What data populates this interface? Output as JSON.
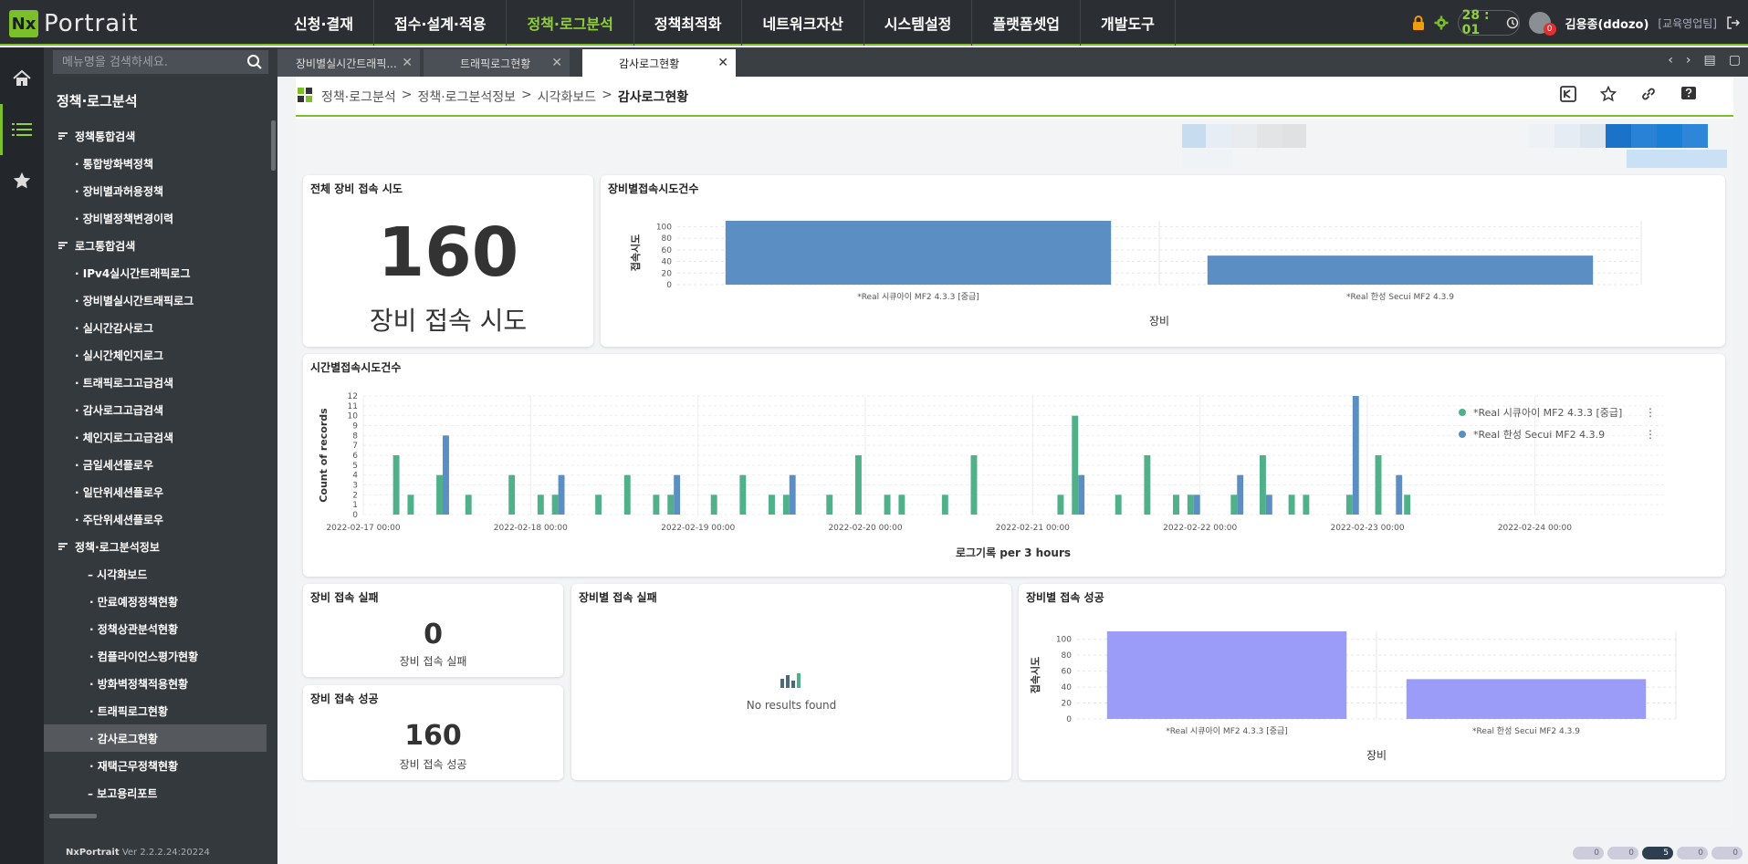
{
  "app": {
    "logo_mark": "Nx",
    "logo_text": "Portrait"
  },
  "nav": [
    {
      "label": "신청·결재"
    },
    {
      "label": "접수·설계·적용"
    },
    {
      "label": "정책·로그분석",
      "active": true
    },
    {
      "label": "정책최적화"
    },
    {
      "label": "네트워크자산"
    },
    {
      "label": "시스템설정"
    },
    {
      "label": "플랫폼셋업"
    },
    {
      "label": "개발도구"
    }
  ],
  "topright": {
    "timer": "28 : 01",
    "user_name": "김용종(ddozo)",
    "user_dept": "[교육영업팀]",
    "badge": "0"
  },
  "sidebar": {
    "search_placeholder": "메뉴명을 검색하세요.",
    "title": "정책·로그분석",
    "items": [
      {
        "label": "정책통합검색",
        "level": 0
      },
      {
        "label": "· 통합방화벽정책",
        "level": 1
      },
      {
        "label": "· 장비별과허용정책",
        "level": 1
      },
      {
        "label": "· 장비별정책변경이력",
        "level": 1
      },
      {
        "label": "로그통합검색",
        "level": 0
      },
      {
        "label": "· IPv4실시간트래픽로그",
        "level": 1
      },
      {
        "label": "· 장비별실시간트래픽로그",
        "level": 1
      },
      {
        "label": "· 실시간감사로그",
        "level": 1
      },
      {
        "label": "· 실시간체인지로그",
        "level": 1
      },
      {
        "label": "· 트래픽로그고급검색",
        "level": 1
      },
      {
        "label": "· 감사로그고급검색",
        "level": 1
      },
      {
        "label": "· 체인지로그고급검색",
        "level": 1
      },
      {
        "label": "· 금일세션플로우",
        "level": 1
      },
      {
        "label": "· 일단위세션플로우",
        "level": 1
      },
      {
        "label": "· 주단위세션플로우",
        "level": 1
      },
      {
        "label": "정책·로그분석정보",
        "level": 0
      },
      {
        "label": "– 시각화보드",
        "level": 2
      },
      {
        "label": "· 만료예정정책현황",
        "level": 3
      },
      {
        "label": "· 정책상관분석현황",
        "level": 3
      },
      {
        "label": "· 컴플라이언스평가현황",
        "level": 3
      },
      {
        "label": "· 방화벽정책적용현황",
        "level": 3
      },
      {
        "label": "· 트래픽로그현황",
        "level": 3
      },
      {
        "label": "· 감사로그현황",
        "level": 3,
        "active": true
      },
      {
        "label": "· 재택근무정책현황",
        "level": 3
      },
      {
        "label": "– 보고용리포트",
        "level": 2
      }
    ],
    "version_name": "NxPortrait",
    "version": "Ver 2.2.2.24:20224"
  },
  "tabs": [
    {
      "label": "장비별실시간트래픽..."
    },
    {
      "label": "트래픽로그현황"
    },
    {
      "label": "감사로그현황",
      "active": true
    }
  ],
  "breadcrumb": {
    "items": [
      "정책·로그분석",
      "정책·로그분석정보",
      "시각화보드"
    ],
    "sep": ">",
    "current": "감사로그현황"
  },
  "panels": {
    "total": {
      "title": "전체 장비 접속 시도",
      "value": "160",
      "label": "장비 접속 시도"
    },
    "fail": {
      "title": "장비 접속 실패",
      "value": "0",
      "label": "장비 접속 실패"
    },
    "success": {
      "title": "장비 접속 성공",
      "value": "160",
      "label": "장비 접속 성공"
    },
    "device_fail": {
      "title": "장비별 접속 실패",
      "empty": "No results found"
    },
    "device_attempt_title": "장비별접속시도건수",
    "time_title": "시간별접속시도건수",
    "device_success_title": "장비별 접속 성공"
  },
  "status_pills": [
    "0",
    "0",
    "5",
    "0",
    "0"
  ],
  "chart_data": [
    {
      "type": "bar",
      "title": "장비별접속시도건수",
      "categories": [
        "*Real 시큐아이 MF2 4.3.3 [중급]",
        "*Real 한성 Secui MF2 4.3.9"
      ],
      "values": [
        110,
        50
      ],
      "xlabel": "장비",
      "ylabel": "접속시도",
      "ylim": [
        0,
        110
      ],
      "yticks": [
        0,
        20,
        40,
        60,
        80,
        100
      ],
      "color": "#5b8ec3"
    },
    {
      "type": "bar",
      "title": "시간별접속시도건수",
      "xlabel": "로그기록 per 3 hours",
      "ylabel": "Count of records",
      "ylim": [
        0,
        12
      ],
      "yticks": [
        0,
        1,
        2,
        3,
        4,
        5,
        6,
        7,
        8,
        9,
        10,
        11,
        12
      ],
      "xticks": [
        "2022-02-17 00:00",
        "2022-02-18 00:00",
        "2022-02-19 00:00",
        "2022-02-20 00:00",
        "2022-02-21 00:00",
        "2022-02-22 00:00",
        "2022-02-23 00:00",
        "2022-02-24 00:00"
      ],
      "legend_position": "top-right",
      "series": [
        {
          "name": "*Real 시큐아이 MF2 4.3.3 [중급]",
          "color": "#4fb08a",
          "values": [
            0,
            0,
            6,
            2,
            0,
            4,
            0,
            2,
            0,
            0,
            4,
            0,
            2,
            2,
            0,
            0,
            2,
            0,
            4,
            0,
            2,
            2,
            0,
            0,
            2,
            0,
            4,
            0,
            2,
            2,
            0,
            0,
            2,
            0,
            6,
            0,
            2,
            2,
            0,
            0,
            2,
            0,
            6,
            0,
            0,
            0,
            0,
            0,
            2,
            10,
            0,
            0,
            2,
            0,
            6,
            0,
            2,
            2,
            0,
            0,
            2,
            0,
            6,
            0,
            2,
            2,
            0,
            0,
            2,
            0,
            6,
            0,
            2,
            0,
            0,
            0,
            0,
            0,
            0,
            0,
            0,
            0,
            0,
            0,
            0,
            0,
            0,
            0,
            0,
            0
          ]
        },
        {
          "name": "*Real 한성 Secui MF2 4.3.9",
          "color": "#5b8ec3",
          "values": [
            0,
            0,
            0,
            0,
            0,
            8,
            0,
            0,
            0,
            0,
            0,
            0,
            0,
            4,
            0,
            0,
            0,
            0,
            0,
            0,
            0,
            4,
            0,
            0,
            0,
            0,
            0,
            0,
            0,
            4,
            0,
            0,
            0,
            0,
            0,
            0,
            0,
            0,
            0,
            0,
            0,
            0,
            0,
            0,
            0,
            0,
            0,
            0,
            0,
            4,
            0,
            0,
            0,
            0,
            0,
            0,
            0,
            2,
            0,
            0,
            4,
            0,
            2,
            0,
            0,
            0,
            0,
            0,
            12,
            0,
            0,
            4,
            0,
            0,
            0,
            0,
            0,
            0,
            0,
            0,
            0,
            0,
            0,
            0,
            0,
            0,
            0,
            0,
            0,
            0
          ]
        }
      ]
    },
    {
      "type": "bar",
      "title": "장비별 접속 성공",
      "categories": [
        "*Real 시큐아이 MF2 4.3.3 [중급]",
        "*Real 한성 Secui MF2 4.3.9"
      ],
      "values": [
        110,
        50
      ],
      "xlabel": "장비",
      "ylabel": "접속시도",
      "ylim": [
        0,
        110
      ],
      "yticks": [
        0,
        20,
        40,
        60,
        80,
        100
      ],
      "color": "#9b9cf7"
    }
  ]
}
